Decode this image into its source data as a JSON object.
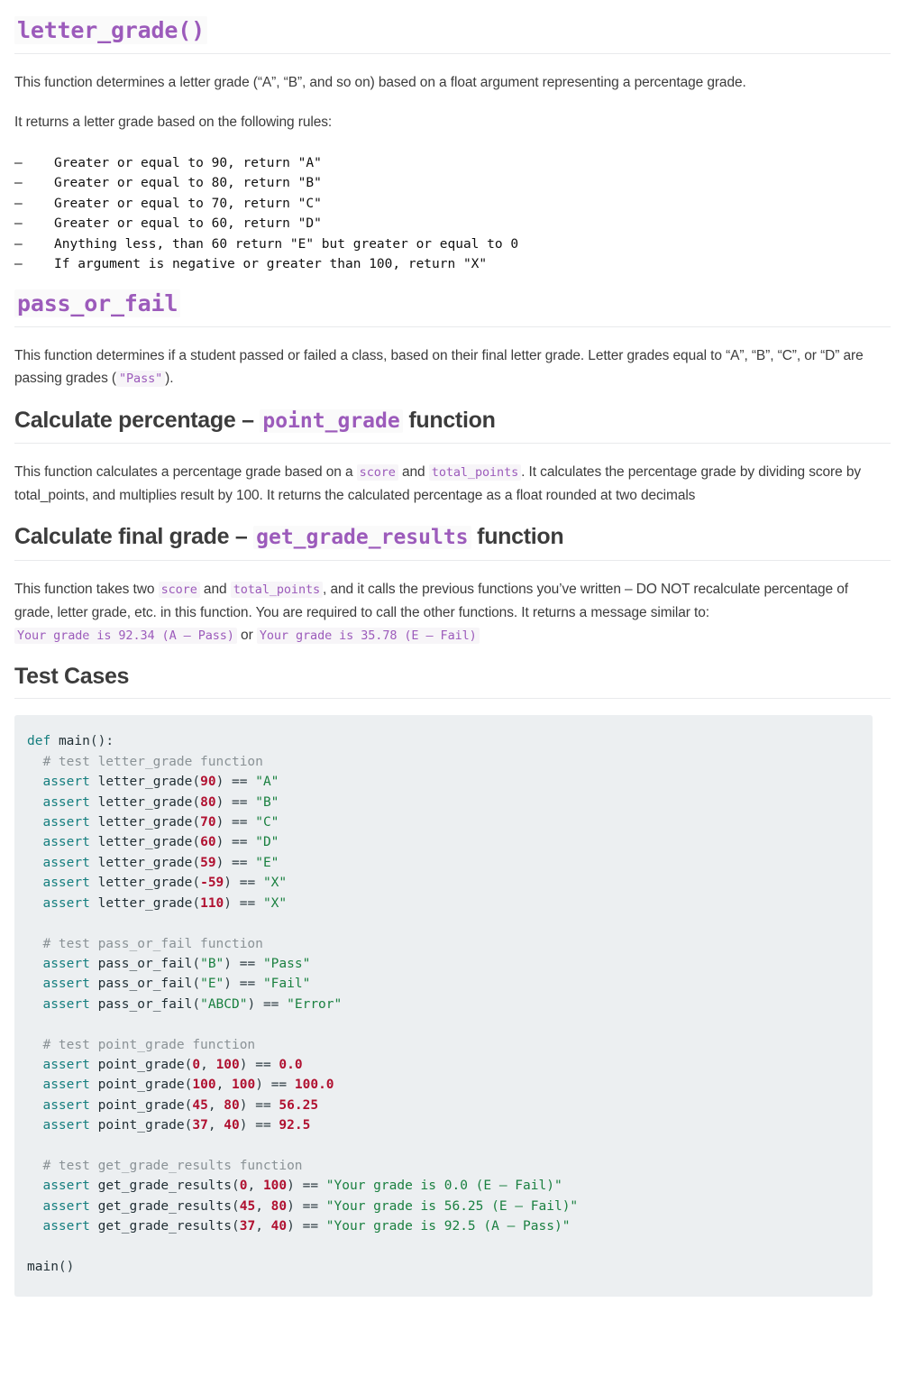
{
  "colors": {
    "accent_purple": "#9c5bbb",
    "heading_text": "#3c3c3c",
    "body_text": "#3c3c3c",
    "code_bg": "#eceff1",
    "inline_code_bg": "#f7f5f8",
    "rule": "#e9eaec",
    "code_keyword": "#157e7e",
    "code_number": "#b01030",
    "code_string": "#1a8040",
    "code_comment": "#8a9296"
  },
  "sections": {
    "letter_grade": {
      "heading": "letter_grade()",
      "intro": "This function determines a letter grade (“A”, “B”, and so on) based on a float argument representing a percentage grade.",
      "rules_intro": "It returns a letter grade based on the following rules:",
      "dash": "–",
      "rules": [
        "Greater or equal to 90, return \"A\"",
        "Greater or equal to 80, return \"B\"",
        "Greater or equal to 70, return \"C\"",
        "Greater or equal to 60, return \"D\"",
        "Anything less, than 60 return \"E\" but greater or equal to 0",
        "If argument is negative or greater than 100, return \"X\""
      ]
    },
    "pass_or_fail": {
      "heading": "pass_or_fail",
      "body_part1": "This function determines if a student passed or failed a class, based on their final letter grade. Letter grades equal to “A”, “B”, “C”, or “D” are passing grades (",
      "body_code": "\"Pass\"",
      "body_part2": ")."
    },
    "point_grade": {
      "heading_part1": "Calculate percentage – ",
      "heading_code": "point_grade",
      "heading_part2": " function",
      "body_part1": "This function calculates a percentage grade based on a ",
      "body_code1": "score",
      "body_part2": " and ",
      "body_code2": "total_points",
      "body_part3": ". It calculates the percentage grade by dividing score by total_points, and multiplies result by 100. It returns the calculated percentage as a float rounded at two decimals"
    },
    "get_grade_results": {
      "heading_part1": "Calculate final grade – ",
      "heading_code": "get_grade_results",
      "heading_part2": " function",
      "body_part1": "This function takes two ",
      "body_code1": "score",
      "body_part2": " and ",
      "body_code2": "total_points",
      "body_part3": ", and it calls the previous functions you’ve written – DO NOT recalculate percentage of grade, letter grade, etc. in this function. You are required to call the other functions. It returns a message similar to: ",
      "example_code1": "Your grade is 92.34 (A – Pass)",
      "body_part4": " or ",
      "example_code2": "Your grade is 35.78 (E – Fail)"
    },
    "test_cases": {
      "heading": "Test Cases",
      "code_lines": [
        [
          {
            "t": "kw",
            "s": "def"
          },
          {
            "t": "pln",
            "s": " "
          },
          {
            "t": "fn",
            "s": "main"
          },
          {
            "t": "op",
            "s": "():"
          }
        ],
        [
          {
            "t": "cmt",
            "s": "  # test letter_grade function"
          }
        ],
        [
          {
            "t": "pln",
            "s": "  "
          },
          {
            "t": "kw",
            "s": "assert"
          },
          {
            "t": "pln",
            "s": " "
          },
          {
            "t": "fn",
            "s": "letter_grade"
          },
          {
            "t": "op",
            "s": "("
          },
          {
            "t": "num",
            "s": "90"
          },
          {
            "t": "op",
            "s": ") == "
          },
          {
            "t": "str",
            "s": "\"A\""
          }
        ],
        [
          {
            "t": "pln",
            "s": "  "
          },
          {
            "t": "kw",
            "s": "assert"
          },
          {
            "t": "pln",
            "s": " "
          },
          {
            "t": "fn",
            "s": "letter_grade"
          },
          {
            "t": "op",
            "s": "("
          },
          {
            "t": "num",
            "s": "80"
          },
          {
            "t": "op",
            "s": ") == "
          },
          {
            "t": "str",
            "s": "\"B\""
          }
        ],
        [
          {
            "t": "pln",
            "s": "  "
          },
          {
            "t": "kw",
            "s": "assert"
          },
          {
            "t": "pln",
            "s": " "
          },
          {
            "t": "fn",
            "s": "letter_grade"
          },
          {
            "t": "op",
            "s": "("
          },
          {
            "t": "num",
            "s": "70"
          },
          {
            "t": "op",
            "s": ") == "
          },
          {
            "t": "str",
            "s": "\"C\""
          }
        ],
        [
          {
            "t": "pln",
            "s": "  "
          },
          {
            "t": "kw",
            "s": "assert"
          },
          {
            "t": "pln",
            "s": " "
          },
          {
            "t": "fn",
            "s": "letter_grade"
          },
          {
            "t": "op",
            "s": "("
          },
          {
            "t": "num",
            "s": "60"
          },
          {
            "t": "op",
            "s": ") == "
          },
          {
            "t": "str",
            "s": "\"D\""
          }
        ],
        [
          {
            "t": "pln",
            "s": "  "
          },
          {
            "t": "kw",
            "s": "assert"
          },
          {
            "t": "pln",
            "s": " "
          },
          {
            "t": "fn",
            "s": "letter_grade"
          },
          {
            "t": "op",
            "s": "("
          },
          {
            "t": "num",
            "s": "59"
          },
          {
            "t": "op",
            "s": ") == "
          },
          {
            "t": "str",
            "s": "\"E\""
          }
        ],
        [
          {
            "t": "pln",
            "s": "  "
          },
          {
            "t": "kw",
            "s": "assert"
          },
          {
            "t": "pln",
            "s": " "
          },
          {
            "t": "fn",
            "s": "letter_grade"
          },
          {
            "t": "op",
            "s": "("
          },
          {
            "t": "num",
            "s": "-59"
          },
          {
            "t": "op",
            "s": ") == "
          },
          {
            "t": "str",
            "s": "\"X\""
          }
        ],
        [
          {
            "t": "pln",
            "s": "  "
          },
          {
            "t": "kw",
            "s": "assert"
          },
          {
            "t": "pln",
            "s": " "
          },
          {
            "t": "fn",
            "s": "letter_grade"
          },
          {
            "t": "op",
            "s": "("
          },
          {
            "t": "num",
            "s": "110"
          },
          {
            "t": "op",
            "s": ") == "
          },
          {
            "t": "str",
            "s": "\"X\""
          }
        ],
        [],
        [
          {
            "t": "cmt",
            "s": "  # test pass_or_fail function"
          }
        ],
        [
          {
            "t": "pln",
            "s": "  "
          },
          {
            "t": "kw",
            "s": "assert"
          },
          {
            "t": "pln",
            "s": " "
          },
          {
            "t": "fn",
            "s": "pass_or_fail"
          },
          {
            "t": "op",
            "s": "("
          },
          {
            "t": "str",
            "s": "\"B\""
          },
          {
            "t": "op",
            "s": ") == "
          },
          {
            "t": "str",
            "s": "\"Pass\""
          }
        ],
        [
          {
            "t": "pln",
            "s": "  "
          },
          {
            "t": "kw",
            "s": "assert"
          },
          {
            "t": "pln",
            "s": " "
          },
          {
            "t": "fn",
            "s": "pass_or_fail"
          },
          {
            "t": "op",
            "s": "("
          },
          {
            "t": "str",
            "s": "\"E\""
          },
          {
            "t": "op",
            "s": ") == "
          },
          {
            "t": "str",
            "s": "\"Fail\""
          }
        ],
        [
          {
            "t": "pln",
            "s": "  "
          },
          {
            "t": "kw",
            "s": "assert"
          },
          {
            "t": "pln",
            "s": " "
          },
          {
            "t": "fn",
            "s": "pass_or_fail"
          },
          {
            "t": "op",
            "s": "("
          },
          {
            "t": "str",
            "s": "\"ABCD\""
          },
          {
            "t": "op",
            "s": ") == "
          },
          {
            "t": "str",
            "s": "\"Error\""
          }
        ],
        [],
        [
          {
            "t": "cmt",
            "s": "  # test point_grade function"
          }
        ],
        [
          {
            "t": "pln",
            "s": "  "
          },
          {
            "t": "kw",
            "s": "assert"
          },
          {
            "t": "pln",
            "s": " "
          },
          {
            "t": "fn",
            "s": "point_grade"
          },
          {
            "t": "op",
            "s": "("
          },
          {
            "t": "num",
            "s": "0"
          },
          {
            "t": "op",
            "s": ", "
          },
          {
            "t": "num",
            "s": "100"
          },
          {
            "t": "op",
            "s": ") == "
          },
          {
            "t": "num",
            "s": "0.0"
          }
        ],
        [
          {
            "t": "pln",
            "s": "  "
          },
          {
            "t": "kw",
            "s": "assert"
          },
          {
            "t": "pln",
            "s": " "
          },
          {
            "t": "fn",
            "s": "point_grade"
          },
          {
            "t": "op",
            "s": "("
          },
          {
            "t": "num",
            "s": "100"
          },
          {
            "t": "op",
            "s": ", "
          },
          {
            "t": "num",
            "s": "100"
          },
          {
            "t": "op",
            "s": ") == "
          },
          {
            "t": "num",
            "s": "100.0"
          }
        ],
        [
          {
            "t": "pln",
            "s": "  "
          },
          {
            "t": "kw",
            "s": "assert"
          },
          {
            "t": "pln",
            "s": " "
          },
          {
            "t": "fn",
            "s": "point_grade"
          },
          {
            "t": "op",
            "s": "("
          },
          {
            "t": "num",
            "s": "45"
          },
          {
            "t": "op",
            "s": ", "
          },
          {
            "t": "num",
            "s": "80"
          },
          {
            "t": "op",
            "s": ") == "
          },
          {
            "t": "num",
            "s": "56.25"
          }
        ],
        [
          {
            "t": "pln",
            "s": "  "
          },
          {
            "t": "kw",
            "s": "assert"
          },
          {
            "t": "pln",
            "s": " "
          },
          {
            "t": "fn",
            "s": "point_grade"
          },
          {
            "t": "op",
            "s": "("
          },
          {
            "t": "num",
            "s": "37"
          },
          {
            "t": "op",
            "s": ", "
          },
          {
            "t": "num",
            "s": "40"
          },
          {
            "t": "op",
            "s": ") == "
          },
          {
            "t": "num",
            "s": "92.5"
          }
        ],
        [],
        [
          {
            "t": "cmt",
            "s": "  # test get_grade_results function"
          }
        ],
        [
          {
            "t": "pln",
            "s": "  "
          },
          {
            "t": "kw",
            "s": "assert"
          },
          {
            "t": "pln",
            "s": " "
          },
          {
            "t": "fn",
            "s": "get_grade_results"
          },
          {
            "t": "op",
            "s": "("
          },
          {
            "t": "num",
            "s": "0"
          },
          {
            "t": "op",
            "s": ", "
          },
          {
            "t": "num",
            "s": "100"
          },
          {
            "t": "op",
            "s": ") == "
          },
          {
            "t": "str",
            "s": "\"Your grade is 0.0 (E – Fail)\""
          }
        ],
        [
          {
            "t": "pln",
            "s": "  "
          },
          {
            "t": "kw",
            "s": "assert"
          },
          {
            "t": "pln",
            "s": " "
          },
          {
            "t": "fn",
            "s": "get_grade_results"
          },
          {
            "t": "op",
            "s": "("
          },
          {
            "t": "num",
            "s": "45"
          },
          {
            "t": "op",
            "s": ", "
          },
          {
            "t": "num",
            "s": "80"
          },
          {
            "t": "op",
            "s": ") == "
          },
          {
            "t": "str",
            "s": "\"Your grade is 56.25 (E – Fail)\""
          }
        ],
        [
          {
            "t": "pln",
            "s": "  "
          },
          {
            "t": "kw",
            "s": "assert"
          },
          {
            "t": "pln",
            "s": " "
          },
          {
            "t": "fn",
            "s": "get_grade_results"
          },
          {
            "t": "op",
            "s": "("
          },
          {
            "t": "num",
            "s": "37"
          },
          {
            "t": "op",
            "s": ", "
          },
          {
            "t": "num",
            "s": "40"
          },
          {
            "t": "op",
            "s": ") == "
          },
          {
            "t": "str",
            "s": "\"Your grade is 92.5 (A – Pass)\""
          }
        ],
        [],
        [
          {
            "t": "fn",
            "s": "main"
          },
          {
            "t": "op",
            "s": "()"
          }
        ]
      ]
    }
  }
}
